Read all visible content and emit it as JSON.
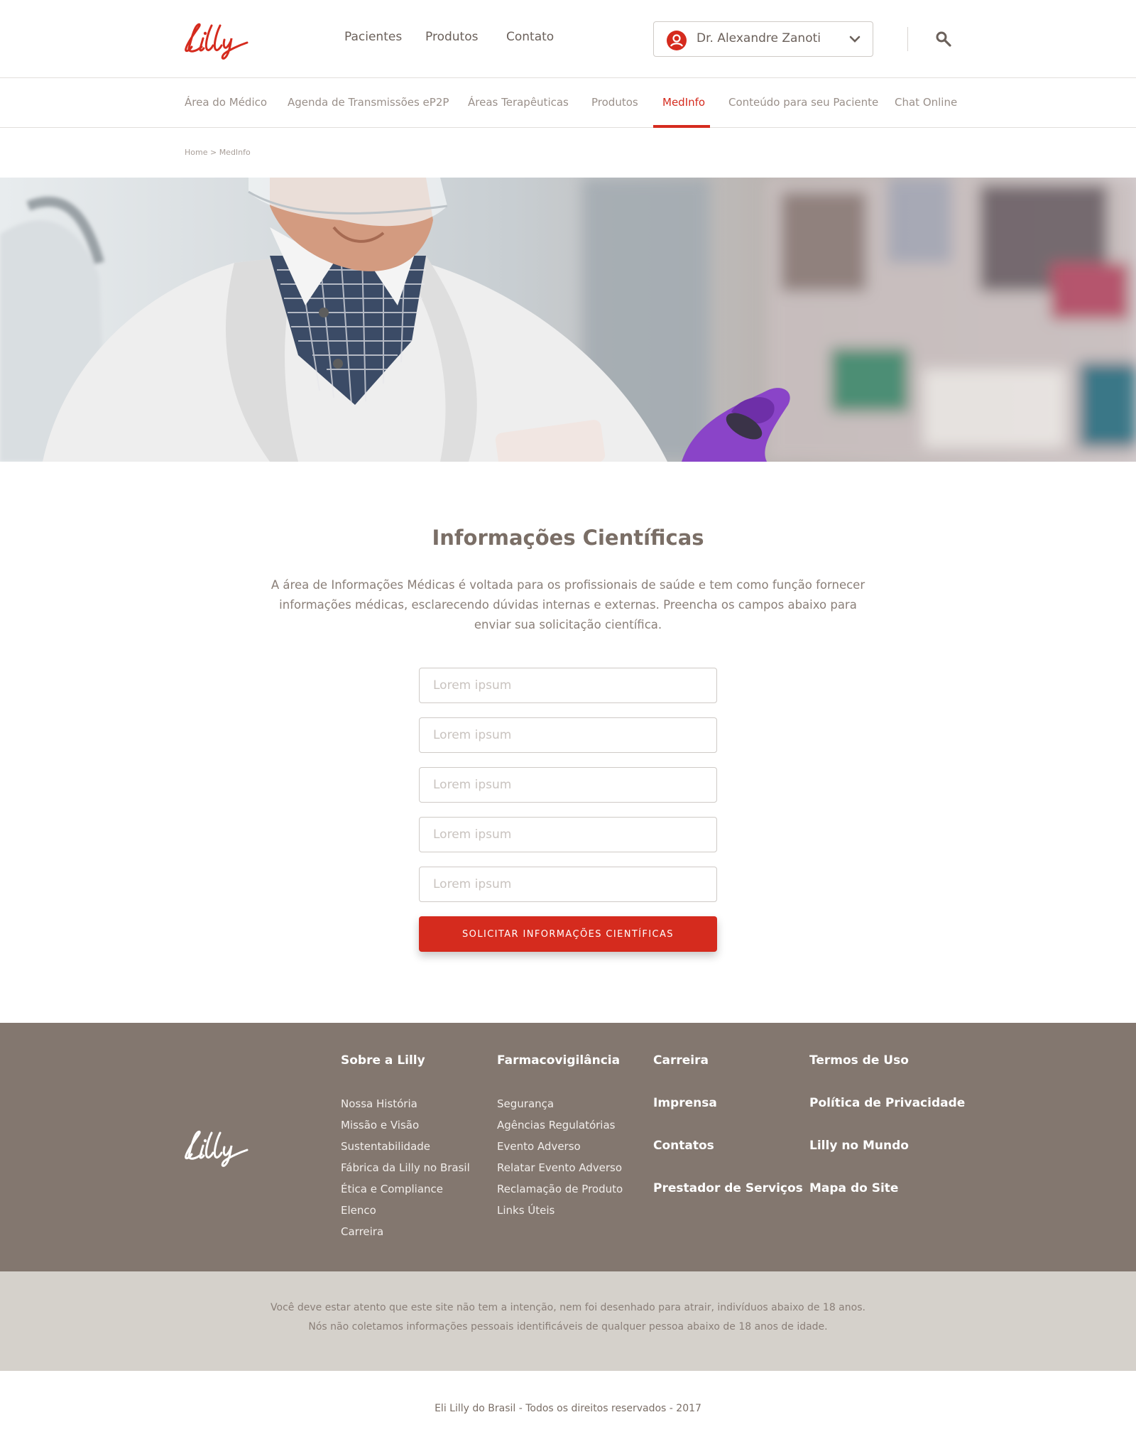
{
  "brand": {
    "logo_text": "Lilly",
    "accent_color": "#d52b1e",
    "footer_bg": "#83776f",
    "disclaimer_bg": "#d5d1cb"
  },
  "topnav": {
    "items": [
      "Pacientes",
      "Produtos",
      "Contato"
    ]
  },
  "user": {
    "name": "Dr. Alexandre Zanoti",
    "icon": "user-icon"
  },
  "search": {
    "icon": "search-icon"
  },
  "subnav": {
    "items": [
      "Área do Médico",
      "Agenda de Transmissões eP2P",
      "Áreas Terapêuticas",
      "Produtos",
      "MedInfo",
      "Conteúdo para seu Paciente",
      "Chat Online"
    ],
    "active": "MedInfo"
  },
  "breadcrumb": "Home > MedInfo",
  "main": {
    "title": "Informações Científicas",
    "description": "A área de Informações Médicas é voltada para os profissionais de saúde e tem como função fornecer informações médicas, esclarecendo dúvidas internas e externas. Preencha os campos abaixo para enviar sua solicitação científica.",
    "fields": [
      {
        "placeholder": "Lorem ipsum",
        "value": ""
      },
      {
        "placeholder": "Lorem ipsum",
        "value": ""
      },
      {
        "placeholder": "Lorem ipsum",
        "value": ""
      },
      {
        "placeholder": "Lorem ipsum",
        "value": ""
      },
      {
        "placeholder": "Lorem ipsum",
        "value": ""
      }
    ],
    "submit_label": "SOLICITAR INFORMAÇÕES CIENTÍFICAS"
  },
  "footer": {
    "col1": {
      "title": "Sobre a Lilly",
      "links": [
        "Nossa História",
        "Missão e Visão",
        "Sustentabilidade",
        "Fábrica da Lilly no Brasil",
        "Ética e Compliance",
        "Elenco",
        "Carreira"
      ]
    },
    "col2": {
      "title": "Farmacovigilância",
      "links": [
        "Segurança",
        "Agências Regulatórias",
        "Evento Adverso",
        "Relatar Evento Adverso",
        "Reclamação de Produto",
        "Links Úteis"
      ]
    },
    "col3": [
      "Carreira",
      "Imprensa",
      "Contatos",
      "Prestador de Serviços"
    ],
    "col4": [
      "Termos de Uso",
      "Política de Privacidade",
      "Lilly no Mundo",
      "Mapa do Site"
    ]
  },
  "disclaimer": {
    "line1": "Você deve estar atento que este site não tem a intenção, nem foi desenhado para atrair, indivíduos abaixo de 18 anos.",
    "line2": "Nós não coletamos informações pessoais identificáveis de qualquer pessoa abaixo de 18 anos de idade."
  },
  "copyright": "Eli Lilly do Brasil - Todos os direitos reservados - 2017"
}
